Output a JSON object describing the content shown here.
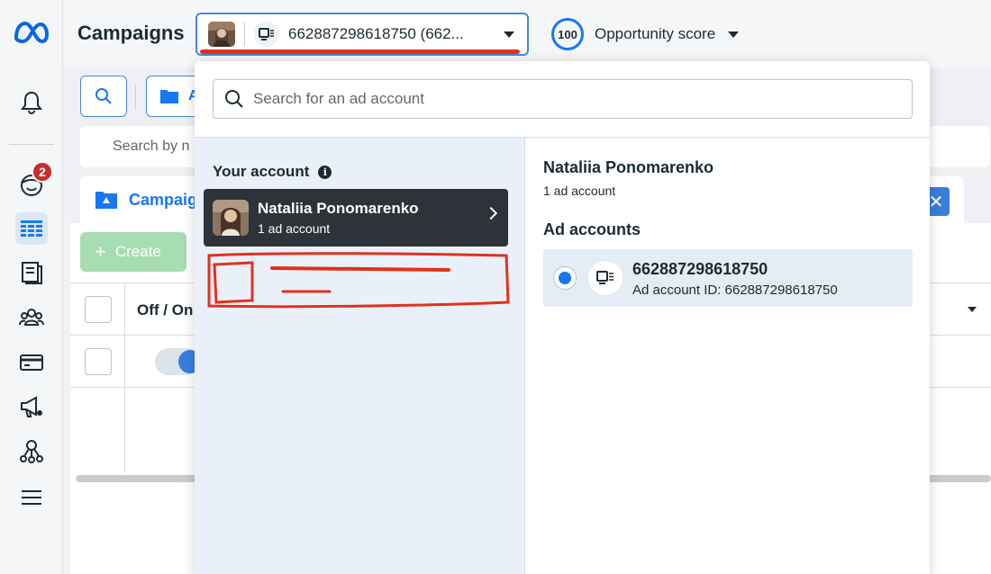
{
  "header": {
    "title": "Campaigns",
    "account_selector_text": "662887298618750 (662...",
    "opportunity_score_value": "100",
    "opportunity_score_label": "Opportunity score"
  },
  "rail": {
    "notifications_badge": "2"
  },
  "background": {
    "folder_button_label": "A",
    "search_placeholder": "Search by n",
    "campaigns_tab_label": "Campaig",
    "create_button_label": "Create",
    "column_header_off_on": "Off / On"
  },
  "dropdown": {
    "search_placeholder": "Search for an ad account",
    "your_account_heading": "Your account",
    "user_name": "Nataliia Ponomarenko",
    "user_account_count": "1 ad account",
    "detail_name": "Nataliia Ponomarenko",
    "detail_account_count": "1 ad account",
    "ad_accounts_heading": "Ad accounts",
    "ad_account": {
      "id": "662887298618750",
      "id_label": "Ad account ID: 662887298618750",
      "selected": true
    }
  },
  "colors": {
    "accent": "#1877f2",
    "annotation_red": "#e0321d",
    "card_dark": "#2d3338",
    "left_panel_bg": "#eaf0f9"
  },
  "icons": [
    "meta-logo-icon",
    "bell-icon",
    "emoji-icon",
    "table-grid-icon",
    "document-icon",
    "people-icon",
    "credit-card-icon",
    "megaphone-icon",
    "network-icon",
    "menu-icon",
    "search-icon",
    "folder-icon",
    "ad-account-icon",
    "info-icon",
    "chevron-right-icon"
  ]
}
